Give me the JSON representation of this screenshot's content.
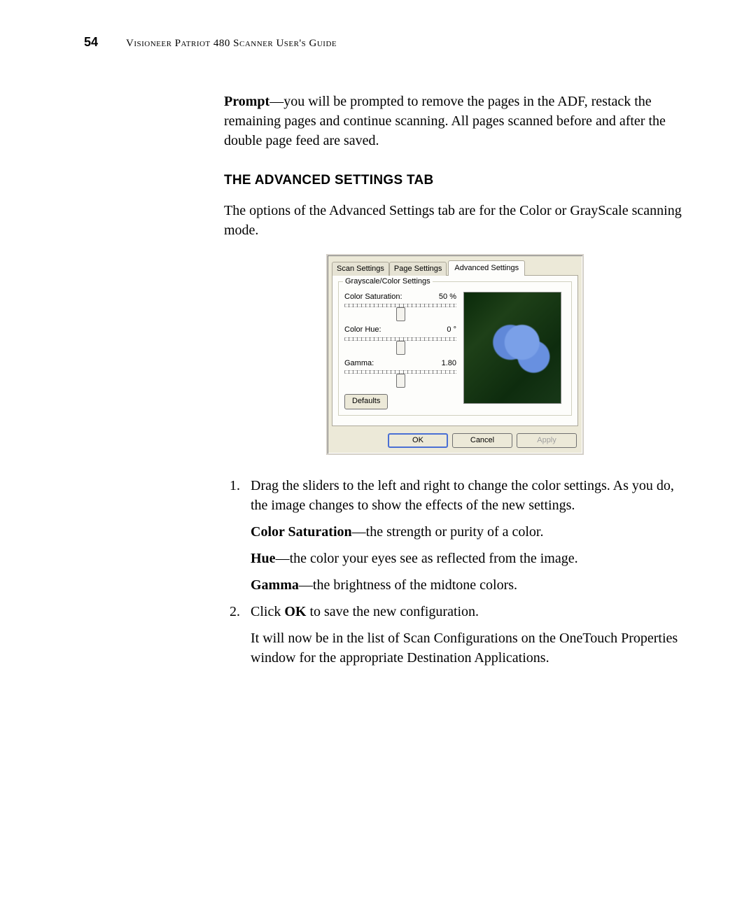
{
  "header": {
    "page_number": "54",
    "running_head": "Visioneer Patriot 480 Scanner User's Guide"
  },
  "intro_para": {
    "lead_bold": "Prompt",
    "rest": "—you will be prompted to remove the pages in the ADF, restack the remaining pages and continue scanning. All pages scanned before and after the double page feed are saved."
  },
  "section_heading": "The Advanced Settings Tab",
  "section_intro": "The options of the Advanced Settings tab are for the Color or GrayScale scanning mode.",
  "dialog": {
    "tabs": {
      "scan": "Scan Settings",
      "page": "Page Settings",
      "advanced": "Advanced Settings"
    },
    "group_label": "Grayscale/Color Settings",
    "sliders": {
      "saturation": {
        "label": "Color Saturation:",
        "value": "50 %"
      },
      "hue": {
        "label": "Color Hue:",
        "value": "0 °"
      },
      "gamma": {
        "label": "Gamma:",
        "value": "1.80"
      }
    },
    "defaults_button": "Defaults",
    "buttons": {
      "ok": "OK",
      "cancel": "Cancel",
      "apply": "Apply"
    }
  },
  "steps": {
    "s1": {
      "main": "Drag the sliders to the left and right to change the color settings. As you do, the image changes to show the effects of the new settings.",
      "sat_bold": "Color Saturation",
      "sat_rest": "—the strength or purity of a color.",
      "hue_bold": "Hue",
      "hue_rest": "—the color your eyes see as reflected from the image.",
      "gamma_bold": "Gamma",
      "gamma_rest": "—the brightness of the midtone colors."
    },
    "s2": {
      "pre": "Click ",
      "ok_bold": "OK",
      "post": " to save the new configuration.",
      "follow": "It will now be in the list of Scan Configurations on the OneTouch Properties window for the appropriate Destination Applications."
    }
  }
}
